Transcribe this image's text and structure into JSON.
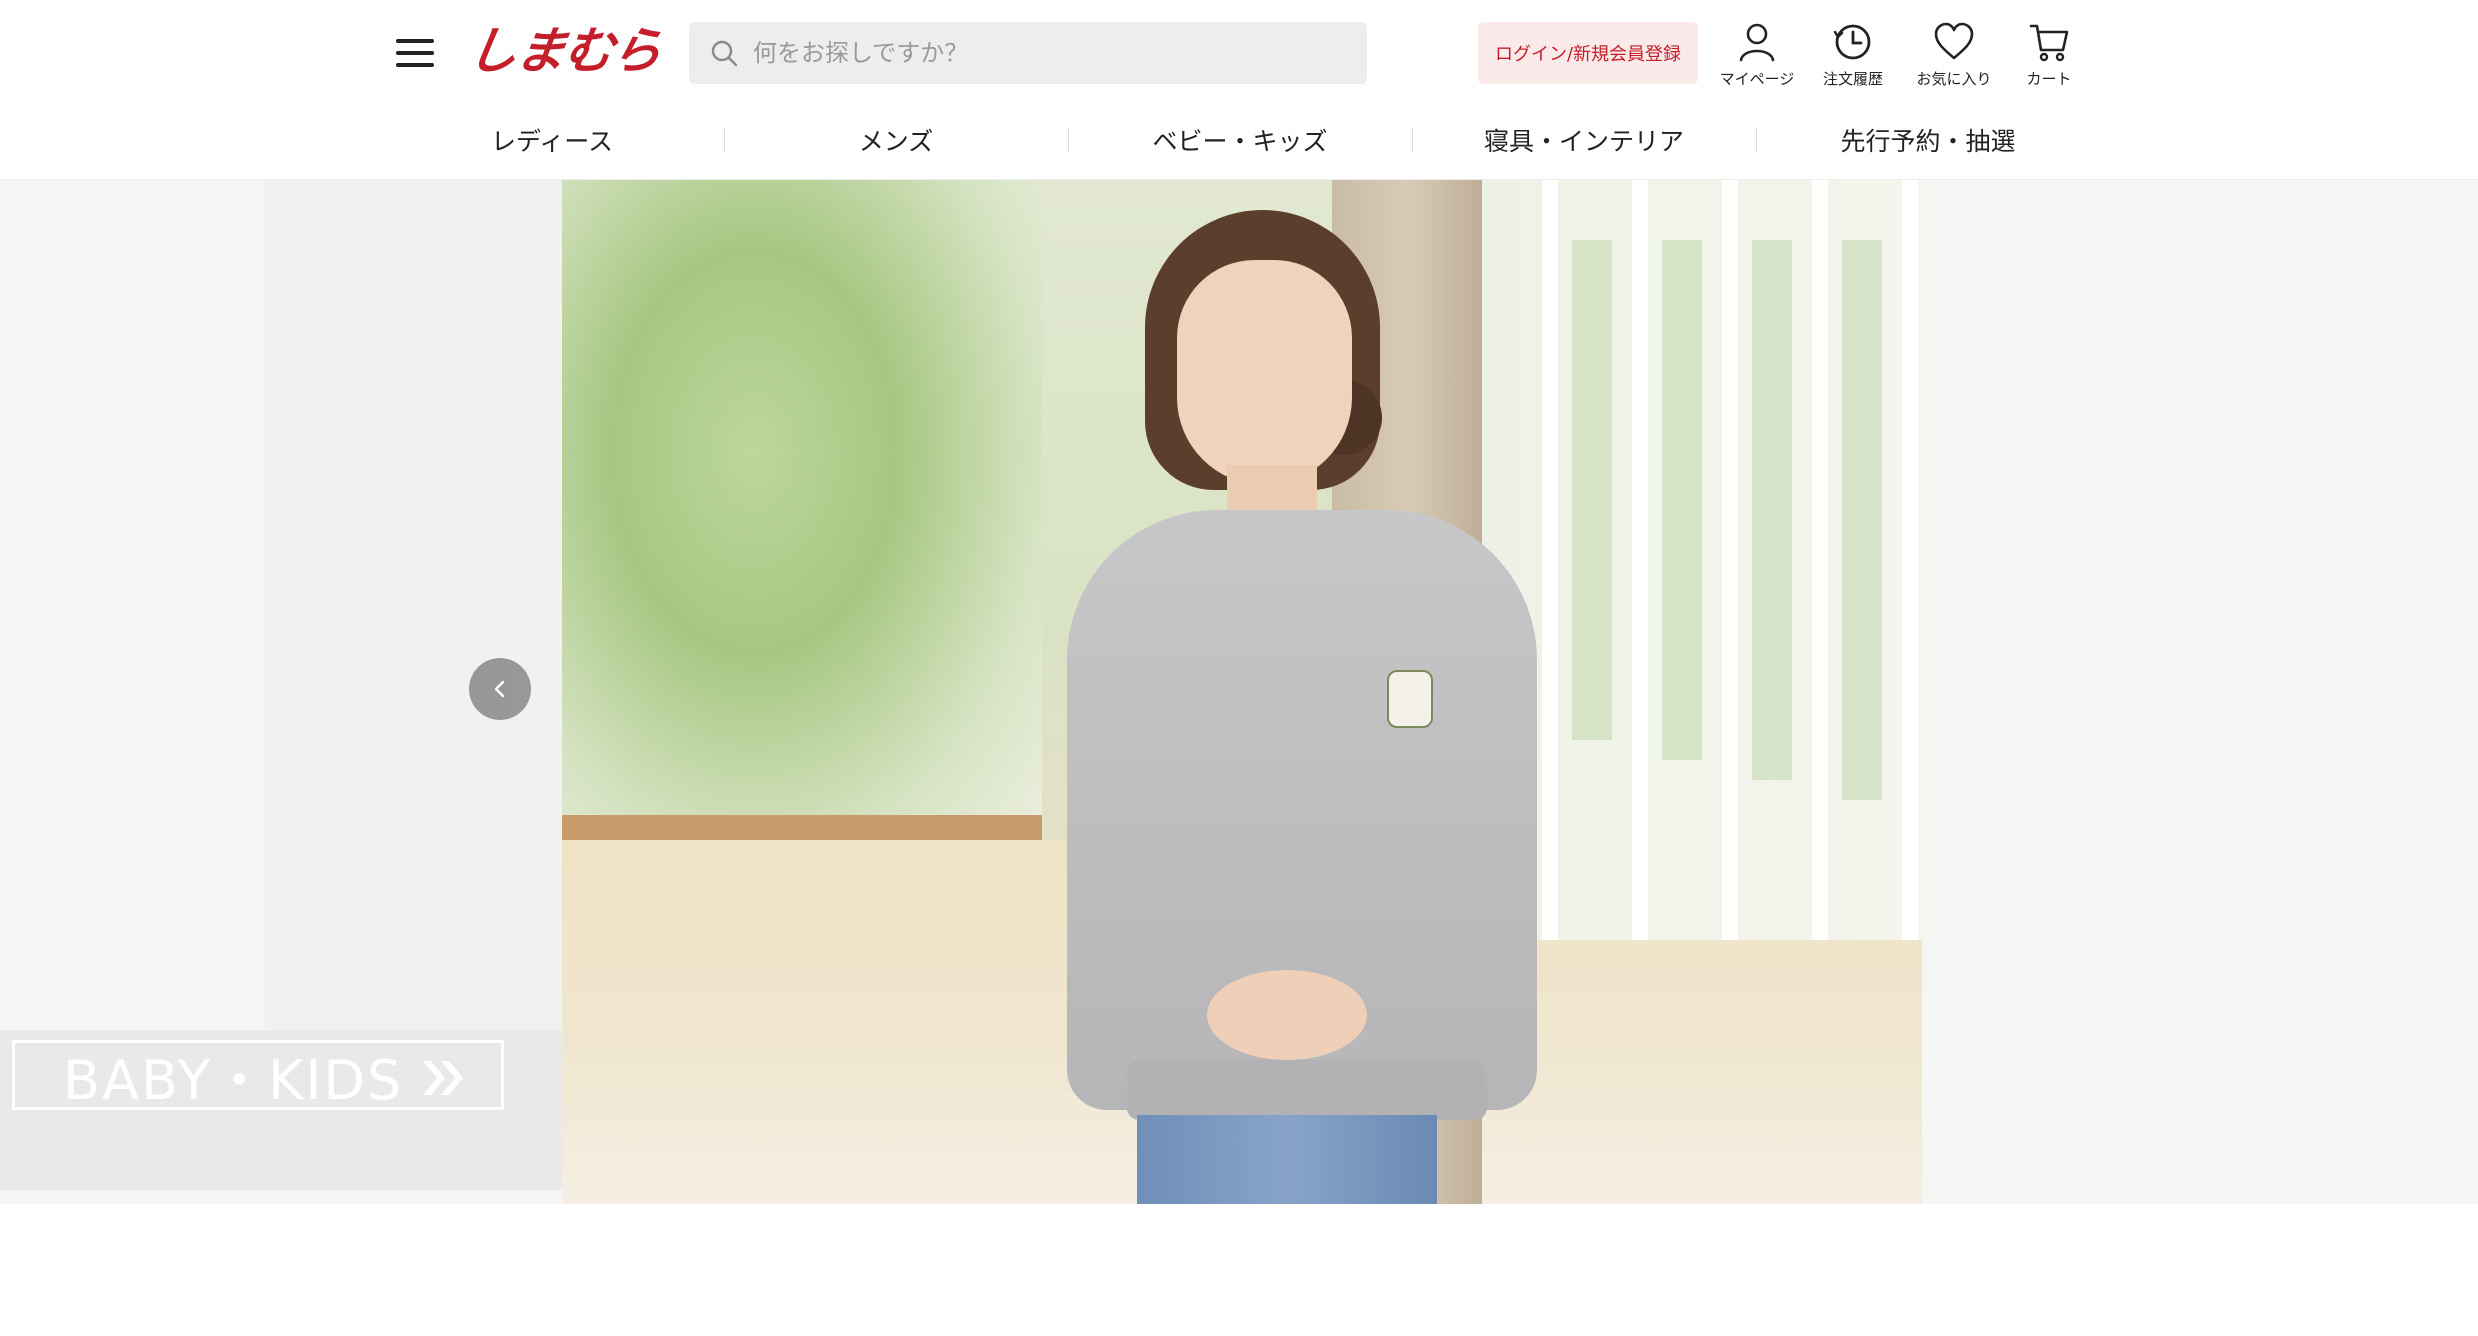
{
  "header": {
    "logo_text": "しまむら",
    "search_placeholder": "何をお探しですか？",
    "login_label": "ログイン/新規会員登録",
    "icons": [
      {
        "name": "mypage",
        "label": "マイページ",
        "icon": "person-icon"
      },
      {
        "name": "order-history",
        "label": "注文履歴",
        "icon": "clock-icon"
      },
      {
        "name": "favorites",
        "label": "お気に入り",
        "icon": "heart-icon"
      },
      {
        "name": "cart",
        "label": "カート",
        "icon": "cart-icon"
      }
    ]
  },
  "nav": {
    "items": [
      {
        "label": "レディース"
      },
      {
        "label": "メンズ"
      },
      {
        "label": "ベビー・キッズ"
      },
      {
        "label": "寝具・インテリア"
      },
      {
        "label": "先行予約・抽選"
      }
    ]
  },
  "carousel": {
    "prev_slide_label": "BABY・KIDS",
    "prev_button_icon": "chevron-left-icon",
    "colors": {
      "brand": "#c41e2a",
      "login_bg": "#fbeaea"
    }
  }
}
